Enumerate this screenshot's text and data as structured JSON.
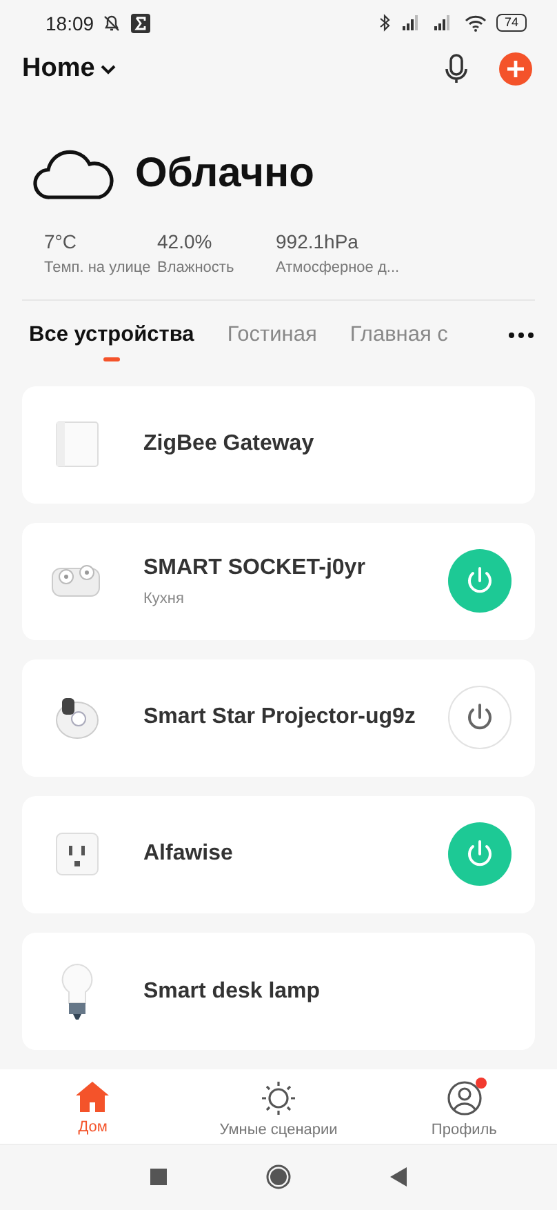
{
  "status_bar": {
    "time": "18:09",
    "battery": "74"
  },
  "header": {
    "home": "Home"
  },
  "weather": {
    "condition": "Облачно",
    "stats": [
      {
        "value": "7°C",
        "label": "Темп. на улице"
      },
      {
        "value": "42.0%",
        "label": "Влажность"
      },
      {
        "value": "992.1hPa",
        "label": "Атмосферное д..."
      }
    ]
  },
  "tabs": [
    {
      "label": "Все устройства",
      "selected": true
    },
    {
      "label": "Гостиная",
      "selected": false
    },
    {
      "label": "Главная с",
      "selected": false
    }
  ],
  "devices": [
    {
      "kind": "gateway",
      "name": "ZigBee Gateway"
    },
    {
      "kind": "socket",
      "name": "SMART SOCKET-j0yr",
      "room": "Кухня",
      "on": true
    },
    {
      "kind": "projector",
      "name": "Smart Star Projector-ug9z",
      "on": false
    },
    {
      "kind": "outlet",
      "name": "Alfawise",
      "on": true
    },
    {
      "kind": "bulb",
      "name": "Smart desk lamp"
    }
  ],
  "bottom_nav": [
    {
      "kind": "home",
      "label": "Дом",
      "selected": true
    },
    {
      "kind": "scenes",
      "label": "Умные сценарии",
      "selected": false
    },
    {
      "kind": "profile",
      "label": "Профиль",
      "selected": false,
      "badge": true
    }
  ]
}
